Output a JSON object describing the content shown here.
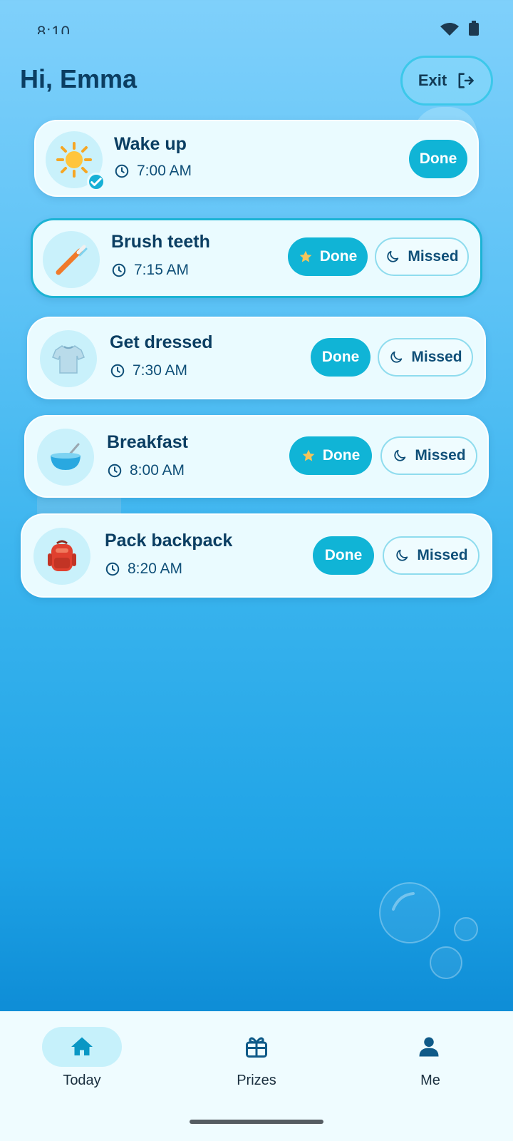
{
  "status_bar": {
    "time": "8:10"
  },
  "header": {
    "greeting": "Hi, Emma",
    "exit_label": "Exit"
  },
  "tasks": [
    {
      "title": "Wake up",
      "time": "7:00 AM",
      "icon": "sun-icon",
      "completed": true,
      "done_label": "Done"
    },
    {
      "title": "Brush teeth",
      "time": "7:15 AM",
      "icon": "toothbrush-icon",
      "done_label": "Done",
      "missed_label": "Missed"
    },
    {
      "title": "Get dressed",
      "time": "7:30 AM",
      "icon": "tshirt-icon",
      "done_label": "Done",
      "missed_label": "Missed"
    },
    {
      "title": "Breakfast",
      "time": "8:00 AM",
      "icon": "bowl-icon",
      "done_label": "Done",
      "missed_label": "Missed"
    },
    {
      "title": "Pack backpack",
      "time": "8:20 AM",
      "icon": "backpack-icon",
      "done_label": "Done",
      "missed_label": "Missed"
    }
  ],
  "bottom_nav": [
    {
      "label": "Today",
      "icon": "home-icon",
      "selected": true
    },
    {
      "label": "Prizes",
      "icon": "gift-icon"
    },
    {
      "label": "Me",
      "icon": "person-icon"
    }
  ],
  "colors": {
    "accent": "#10b4d6",
    "text_dark": "#0b3e62",
    "card_bg": "#eafbff",
    "star": "#f4c55a"
  }
}
